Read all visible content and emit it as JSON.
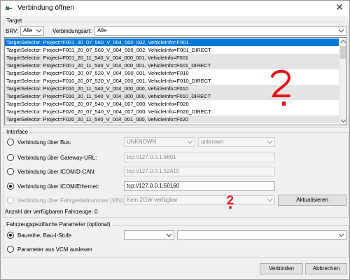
{
  "window": {
    "title": "Verbindung öffnen",
    "close_glyph": "✕",
    "icon": "plug-icon"
  },
  "target": {
    "group_label": "Target",
    "brv_label": "BRV:",
    "brv_value": "Alle",
    "art_label": "Verbindungsart:",
    "art_value": "Alle",
    "rows": [
      "TargetSelector: Project=F001_20_07_560_V_004_000_002, VehicleInfo=F001",
      "TargetSelector: Project=F001_20_07_560_V_004_000_002, VehicleInfo=F001_DIRECT",
      "TargetSelector: Project=F001_20_11_540_V_004_000_001, VehicleInfo=F001",
      "TargetSelector: Project=F001_20_11_540_V_004_000_001, VehicleInfo=F001_DIRECT",
      "TargetSelector: Project=F010_20_07_520_V_004_000_001, VehicleInfo=F010",
      "TargetSelector: Project=F010_20_07_520_V_004_000_001, VehicleInfo=F010_DIRECT",
      "TargetSelector: Project=F010_20_11_540_V_004_000_000, VehicleInfo=F010",
      "TargetSelector: Project=F010_20_11_540_V_004_000_000, VehicleInfo=F010_DIRECT",
      "TargetSelector: Project=F020_20_07_540_V_004_007_000, VehicleInfo=F020",
      "TargetSelector: Project=F020_20_07_540_V_004_007_000, VehicleInfo=F020_DIRECT",
      "TargetSelector: Project=F020_20_11_540_V_004_001_000, VehicleInfo=F020"
    ]
  },
  "interface": {
    "group_label": "Interface",
    "bus_label": "Verbindung über Bus:",
    "bus_value": "UNKNOWN",
    "bus_value2": "unknown",
    "gateway_label": "Verbindung über Gateway-URL:",
    "gateway_value": "tcp://127.0.0.1:6801",
    "dcan_label": "Verbindung über ICOM/D-CAN:",
    "dcan_value": "tcp://127.0.0.1:52410",
    "ethernet_label": "Verbindung über ICOM/Ethernet:",
    "ethernet_value": "tcp://127.0.0.1:50160",
    "vin_label": "Verbindung über Fahrgestellnummer (VIN):",
    "vin_value": "Kein ZGW verfügbar",
    "refresh_label": "Aktualisieren",
    "count_label": "Anzahl der verfügbaren Fahrzeuge: 0"
  },
  "params": {
    "group_label": "Fahrzeugspezifische Parameter (optional)",
    "baureihe_label": "Baureihe, Bau-I-Stufe",
    "vcm_label": "Parameter aus VCM auslesen"
  },
  "footer": {
    "connect_label": "Verbinden",
    "cancel_label": "Abbrechen"
  },
  "colors": {
    "selection": "#0078d7",
    "annotation": "#e0141e"
  }
}
